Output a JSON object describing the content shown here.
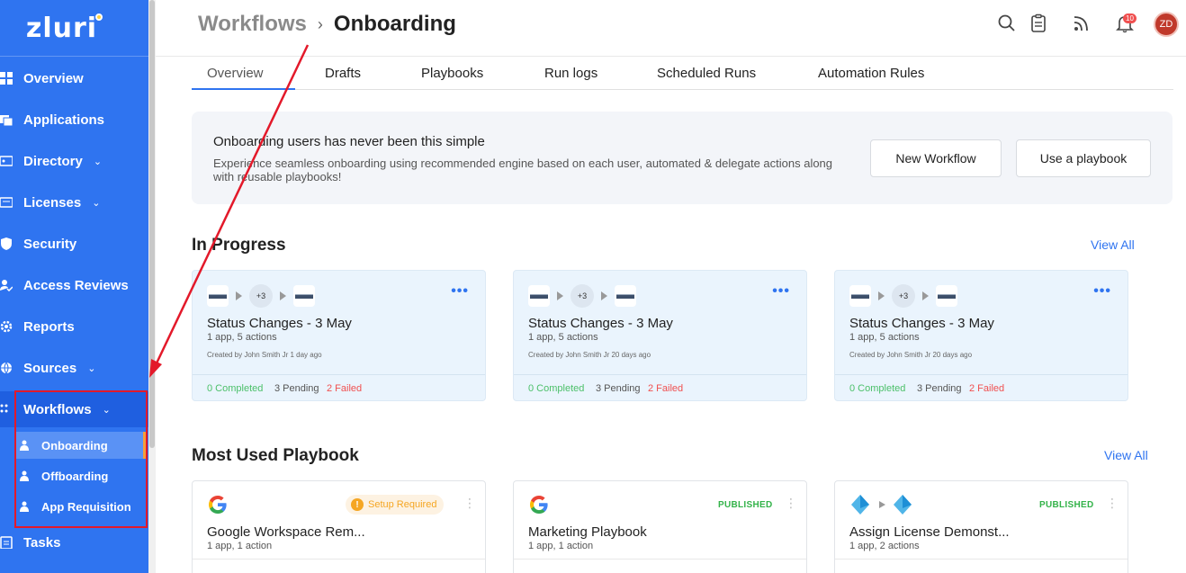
{
  "app": {
    "logo": "zluri"
  },
  "sidebar": {
    "items": [
      {
        "label": "Overview",
        "icon": "grid-icon"
      },
      {
        "label": "Applications",
        "icon": "window-icon"
      },
      {
        "label": "Directory",
        "icon": "id-card-icon",
        "chevron": "⌄"
      },
      {
        "label": "Licenses",
        "icon": "license-icon",
        "chevron": "⌄"
      },
      {
        "label": "Security",
        "icon": "shield-icon"
      },
      {
        "label": "Access Reviews",
        "icon": "user-check-icon"
      },
      {
        "label": "Reports",
        "icon": "gear-report-icon"
      },
      {
        "label": "Sources",
        "icon": "globe-icon",
        "chevron": "⌄"
      },
      {
        "label": "Workflows",
        "icon": "workflow-icon",
        "chevron": "⌄"
      },
      {
        "label": "Tasks",
        "icon": "clipboard-icon"
      }
    ],
    "sub_items": [
      {
        "label": "Onboarding",
        "icon": "user-add-icon"
      },
      {
        "label": "Offboarding",
        "icon": "user-remove-icon"
      },
      {
        "label": "App Requisition",
        "icon": "user-request-icon"
      }
    ]
  },
  "header": {
    "breadcrumb_parent": "Workflows",
    "breadcrumb_sep": "›",
    "breadcrumb_current": "Onboarding",
    "notification_count": "10",
    "avatar_initials": "ZD"
  },
  "tabs": [
    "Overview",
    "Drafts",
    "Playbooks",
    "Run logs",
    "Scheduled Runs",
    "Automation Rules"
  ],
  "banner": {
    "title": "Onboarding users has never been this simple",
    "description": "Experience seamless onboarding using recommended engine based on each user, automated & delegate actions along with reusable playbooks!",
    "new_workflow": "New Workflow",
    "use_playbook": "Use a playbook"
  },
  "in_progress": {
    "title": "In Progress",
    "view_all": "View All",
    "cards": [
      {
        "plus": "+3",
        "title": "Status Changes - 3 May",
        "meta": "1 app, 5 actions",
        "created": "Created by John Smith Jr 1 day ago",
        "completed": "0 Completed",
        "pending": "3 Pending",
        "failed": "2 Failed"
      },
      {
        "plus": "+3",
        "title": "Status Changes - 3 May",
        "meta": "1 app, 5 actions",
        "created": "Created by John Smith Jr 20 days ago",
        "completed": "0 Completed",
        "pending": "3 Pending",
        "failed": "2 Failed"
      },
      {
        "plus": "+3",
        "title": "Status Changes - 3 May",
        "meta": "1 app, 5 actions",
        "created": "Created by John Smith Jr 20 days ago",
        "completed": "0 Completed",
        "pending": "3 Pending",
        "failed": "2 Failed"
      }
    ]
  },
  "most_used": {
    "title": "Most Used Playbook",
    "view_all": "View All",
    "cards": [
      {
        "title": "Google Workspace Rem...",
        "meta": "1 app, 1 action",
        "status": "Setup Required",
        "icon": "google-icon"
      },
      {
        "title": "Marketing Playbook",
        "meta": "1 app, 1 action",
        "status": "PUBLISHED",
        "icon": "google-icon"
      },
      {
        "title": "Assign License Demonst...",
        "meta": "1 app, 2 actions",
        "status": "PUBLISHED",
        "icon": "azure-icon"
      }
    ]
  },
  "colors": {
    "sidebar_bg": "#2f74f0",
    "accent": "#2f74f0",
    "completed": "#4cc06a",
    "failed": "#f05050",
    "published": "#34b34a",
    "warning": "#f5a623",
    "annotation": "#e3192a"
  }
}
